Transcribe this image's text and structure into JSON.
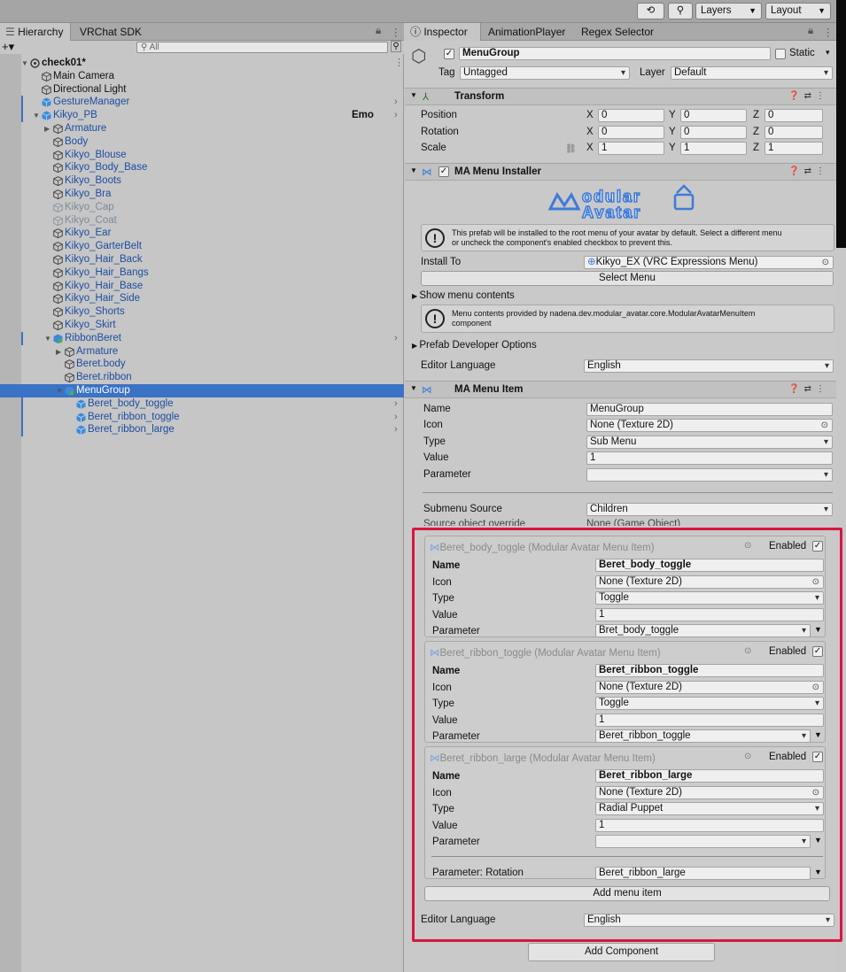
{
  "topbar": {
    "layers": "Layers",
    "layout": "Layout"
  },
  "hierarchy": {
    "tab": "Hierarchy",
    "tab2": "VRChat SDK",
    "search_placeholder": "All",
    "rows": [
      "check01*",
      "Main Camera",
      "Directional Light",
      "GestureManager",
      "Kikyo_PB",
      "Armature",
      "Body",
      "Kikyo_Blouse",
      "Kikyo_Body_Base",
      "Kikyo_Boots",
      "Kikyo_Bra",
      "Kikyo_Cap",
      "Kikyo_Coat",
      "Kikyo_Ear",
      "Kikyo_GarterBelt",
      "Kikyo_Hair_Back",
      "Kikyo_Hair_Bangs",
      "Kikyo_Hair_Base",
      "Kikyo_Hair_Side",
      "Kikyo_Shorts",
      "Kikyo_Skirt",
      "RibbonBeret",
      "Armature",
      "Beret.body",
      "Beret.ribbon",
      "MenuGroup",
      "Beret_body_toggle",
      "Beret_ribbon_toggle",
      "Beret_ribbon_large"
    ],
    "emo": "Emo"
  },
  "inspector": {
    "tabs": [
      "Inspector",
      "AnimationPlayer",
      "Regex Selector"
    ],
    "object_name": "MenuGroup",
    "static": "Static",
    "tag_label": "Tag",
    "tag": "Untagged",
    "layer_label": "Layer",
    "layer": "Default",
    "transform": {
      "title": "Transform",
      "rows": [
        "Position",
        "Rotation",
        "Scale"
      ],
      "axes": [
        "X",
        "Y",
        "Z"
      ],
      "values": [
        [
          "0",
          "0",
          "0"
        ],
        [
          "0",
          "0",
          "0"
        ],
        [
          "1",
          "1",
          "1"
        ]
      ]
    },
    "installer": {
      "title": "MA Menu Installer",
      "logo1": "odular",
      "logo2": "Avatar",
      "help": "This prefab will be installed to the root menu of your avatar by default. Select a different menu\nor uncheck the component's enabled checkbox to prevent this.",
      "install_to_label": "Install To",
      "install_to": "Kikyo_EX (VRC Expressions Menu)",
      "select_menu": "Select Menu",
      "show_contents": "Show menu contents",
      "help2": "Menu contents provided by nadena.dev.modular_avatar.core.ModularAvatarMenuItem\ncomponent",
      "prefab_dev": "Prefab Developer Options",
      "editor_lang_label": "Editor Language",
      "editor_lang": "English"
    },
    "menuitem": {
      "title": "MA Menu Item",
      "labels": [
        "Name",
        "Icon",
        "Type",
        "Value",
        "Parameter"
      ],
      "values": [
        "MenuGroup",
        "None (Texture 2D)",
        "Sub Menu",
        "1",
        ""
      ],
      "submenu_source_label": "Submenu Source",
      "submenu_source": "Children",
      "source_override_label": "Source object override",
      "source_override": "None (Game Object)"
    },
    "subitems": [
      {
        "header": "Beret_body_toggle (Modular Avatar Menu Item)",
        "enabled": "Enabled",
        "name": "Beret_body_toggle",
        "icon": "None (Texture 2D)",
        "type": "Toggle",
        "value": "1",
        "parameter": "Bret_body_toggle"
      },
      {
        "header": "Beret_ribbon_toggle (Modular Avatar Menu Item)",
        "enabled": "Enabled",
        "name": "Beret_ribbon_toggle",
        "icon": "None (Texture 2D)",
        "type": "Toggle",
        "value": "1",
        "parameter": "Beret_ribbon_toggle"
      },
      {
        "header": "Beret_ribbon_large (Modular Avatar Menu Item)",
        "enabled": "Enabled",
        "name": "Beret_ribbon_large",
        "icon": "None (Texture 2D)",
        "type": "Radial Puppet",
        "value": "1",
        "parameter": "",
        "rotation_label": "Parameter: Rotation",
        "rotation": "Beret_ribbon_large"
      }
    ],
    "field_labels": [
      "Name",
      "Icon",
      "Type",
      "Value",
      "Parameter"
    ],
    "add_menu_item": "Add menu item",
    "editor_lang_label": "Editor Language",
    "editor_lang": "English",
    "add_component": "Add Component"
  },
  "colors": {
    "highlight": "#d8163f",
    "selection": "#3a72c5",
    "prefab_text": "#1c4da0"
  }
}
